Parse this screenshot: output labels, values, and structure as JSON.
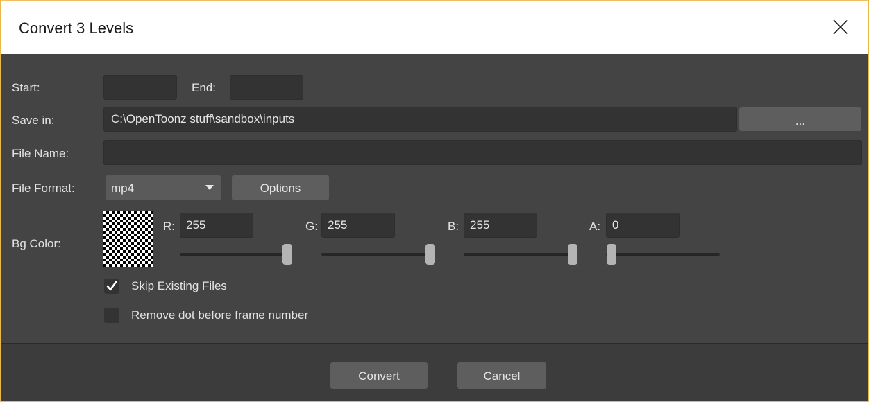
{
  "window": {
    "title": "Convert 3 Levels"
  },
  "range": {
    "start_label": "Start:",
    "start_value": "",
    "end_label": "End:",
    "end_value": ""
  },
  "save_in": {
    "label": "Save in:",
    "path": "C:\\OpenToonz stuff\\sandbox\\inputs",
    "browse_label": "..."
  },
  "file_name": {
    "label": "File Name:",
    "value": ""
  },
  "file_format": {
    "label": "File Format:",
    "selected": "mp4",
    "options_label": "Options"
  },
  "bg_color": {
    "label": "Bg Color:",
    "channels": [
      {
        "label": "R:",
        "value": "255",
        "level": 1.0
      },
      {
        "label": "G:",
        "value": "255",
        "level": 1.0
      },
      {
        "label": "B:",
        "value": "255",
        "level": 1.0
      },
      {
        "label": "A:",
        "value": "0",
        "level": 0.0
      }
    ]
  },
  "options": {
    "skip_existing": {
      "label": "Skip Existing Files",
      "checked": true
    },
    "remove_dot": {
      "label": "Remove dot before frame number",
      "checked": false
    }
  },
  "footer": {
    "convert_label": "Convert",
    "cancel_label": "Cancel"
  },
  "colors": {
    "dialog_bg": "#444444",
    "field_bg": "#333333",
    "button_bg": "#5e5e5e",
    "handle": "#b4b4b4"
  }
}
